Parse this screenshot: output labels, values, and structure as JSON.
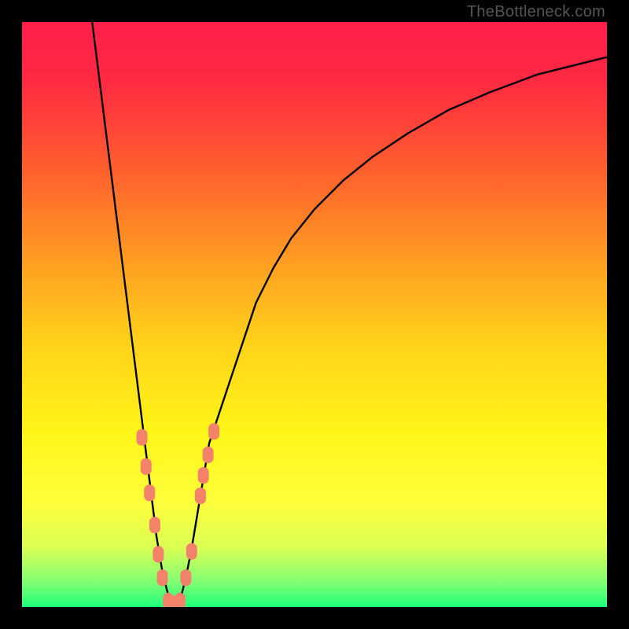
{
  "watermark": "TheBottleneck.com",
  "colors": {
    "gradient_stops": [
      {
        "pos": 0.0,
        "color": "#ff1f4a"
      },
      {
        "pos": 0.1,
        "color": "#ff2a42"
      },
      {
        "pos": 0.25,
        "color": "#ff5e2e"
      },
      {
        "pos": 0.4,
        "color": "#ff9a22"
      },
      {
        "pos": 0.55,
        "color": "#ffd21a"
      },
      {
        "pos": 0.7,
        "color": "#fff518"
      },
      {
        "pos": 0.82,
        "color": "#fffe3a"
      },
      {
        "pos": 0.9,
        "color": "#d9ff55"
      },
      {
        "pos": 0.96,
        "color": "#7cff73"
      },
      {
        "pos": 1.0,
        "color": "#1eff7a"
      }
    ],
    "curve": "#000000",
    "marker_fill": "#f2826a",
    "marker_stroke": "#f2826a",
    "frame": "#000000"
  },
  "chart_data": {
    "type": "line",
    "title": "",
    "xlabel": "",
    "ylabel": "",
    "xlim": [
      0,
      100
    ],
    "ylim": [
      0,
      100
    ],
    "series": [
      {
        "name": "curve",
        "x": [
          12,
          13,
          14,
          15,
          16,
          17,
          18,
          19,
          20,
          21,
          22,
          23,
          24,
          25,
          26,
          27,
          28,
          29,
          30,
          31,
          32,
          34,
          36,
          38,
          40,
          43,
          46,
          50,
          55,
          60,
          66,
          73,
          80,
          88,
          96,
          100
        ],
        "y": [
          100,
          92,
          84,
          76,
          68,
          60,
          52,
          44,
          36,
          28,
          20,
          12,
          6,
          2,
          0,
          1,
          5,
          10,
          16,
          22,
          28,
          34,
          40,
          46,
          52,
          58,
          63,
          68,
          73,
          77,
          81,
          85,
          88,
          91,
          93,
          94
        ]
      }
    ],
    "markers": [
      {
        "x": 20.5,
        "y": 29.0
      },
      {
        "x": 21.2,
        "y": 24.0
      },
      {
        "x": 21.8,
        "y": 19.5
      },
      {
        "x": 22.7,
        "y": 14.0
      },
      {
        "x": 23.3,
        "y": 9.0
      },
      {
        "x": 24.0,
        "y": 5.0
      },
      {
        "x": 25.0,
        "y": 1.0
      },
      {
        "x": 26.0,
        "y": 0.5
      },
      {
        "x": 27.0,
        "y": 1.0
      },
      {
        "x": 28.0,
        "y": 5.0
      },
      {
        "x": 29.0,
        "y": 9.5
      },
      {
        "x": 30.5,
        "y": 19.0
      },
      {
        "x": 31.0,
        "y": 22.5
      },
      {
        "x": 31.8,
        "y": 26.0
      },
      {
        "x": 32.8,
        "y": 30.0
      }
    ]
  }
}
